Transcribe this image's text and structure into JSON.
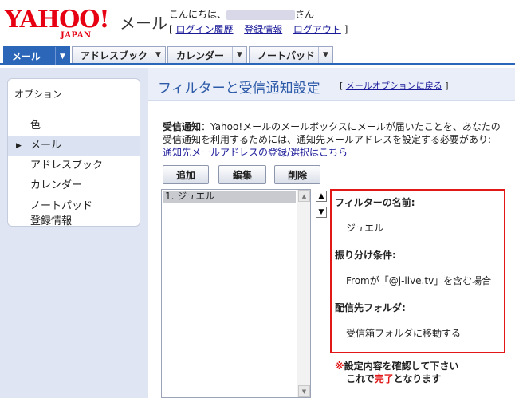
{
  "header": {
    "logo_main": "YAHOO!",
    "logo_sub": "JAPAN",
    "brand": "メール",
    "greeting_prefix": "こんにちは、",
    "greeting_suffix": "さん",
    "link_bracket_open": "[",
    "link_bracket_close": "]",
    "links": [
      {
        "label": "ログイン履歴"
      },
      {
        "label": "登録情報"
      },
      {
        "label": "ログアウト"
      }
    ],
    "link_sep": "–"
  },
  "tabs": [
    {
      "label": "メール"
    },
    {
      "label": "アドレスブック"
    },
    {
      "label": "カレンダー"
    },
    {
      "label": "ノートパッド"
    }
  ],
  "sidebar": {
    "title": "オプション",
    "items": [
      {
        "label": "色"
      },
      {
        "label": "メール"
      },
      {
        "label": "アドレスブック"
      },
      {
        "label": "カレンダー"
      },
      {
        "label": "ノートパッド"
      },
      {
        "label": "登録情報"
      }
    ]
  },
  "main": {
    "title": "フィルターと受信通知設定",
    "back_link": "メールオプションに戻る",
    "notice": {
      "label": "受信通知",
      "line1": "：Yahoo!メールのメールボックスにメールが届いたことを、あなたの",
      "line2": "受信通知を利用するためには、通知先メールアドレスを設定する必要があり:",
      "link": "通知先メールアドレスの登録/選択はこちら"
    },
    "buttons": {
      "add": "追加",
      "edit": "編集",
      "delete": "削除"
    },
    "filters": [
      {
        "label": "1. ジュエル"
      }
    ],
    "detail": {
      "name_label": "フィルターの名前:",
      "name_value": "ジュエル",
      "cond_label": "振り分け条件:",
      "cond_value": "Fromが「@j-live.tv」を含む場合",
      "folder_label": "配信先フォルダ:",
      "folder_value": "受信箱フォルダに移動する"
    },
    "warning": {
      "mark": "※",
      "line1": "設定内容を確認して下さい",
      "line2_pre": "これで",
      "line2_em": "完了",
      "line2_post": "となります"
    }
  },
  "colors": {
    "brand_red": "#e60012",
    "tab_active": "#2b66b8",
    "highlight_border": "#e21818"
  }
}
